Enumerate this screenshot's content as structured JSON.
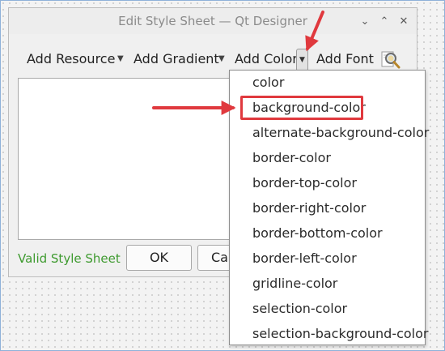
{
  "window": {
    "title": "Edit Style Sheet — Qt Designer",
    "controls": {
      "collapse": "⌄",
      "maximize": "⌃",
      "close": "✕"
    }
  },
  "toolbar": {
    "add_resource": "Add Resource",
    "add_gradient": "Add Gradient",
    "add_color": "Add Color",
    "add_font": "Add Font",
    "dropdown_glyph": "▼"
  },
  "status": {
    "text": "Valid Style Sheet",
    "color": "#3e9a2f"
  },
  "buttons": {
    "ok": "OK",
    "cancel_partial": "Ca"
  },
  "color_menu": {
    "items": [
      "color",
      "background-color",
      "alternate-background-color",
      "border-color",
      "border-top-color",
      "border-right-color",
      "border-bottom-color",
      "border-left-color",
      "gridline-color",
      "selection-color",
      "selection-background-color"
    ],
    "highlighted": "background-color"
  },
  "annotation": {
    "color": "#e0393e"
  }
}
